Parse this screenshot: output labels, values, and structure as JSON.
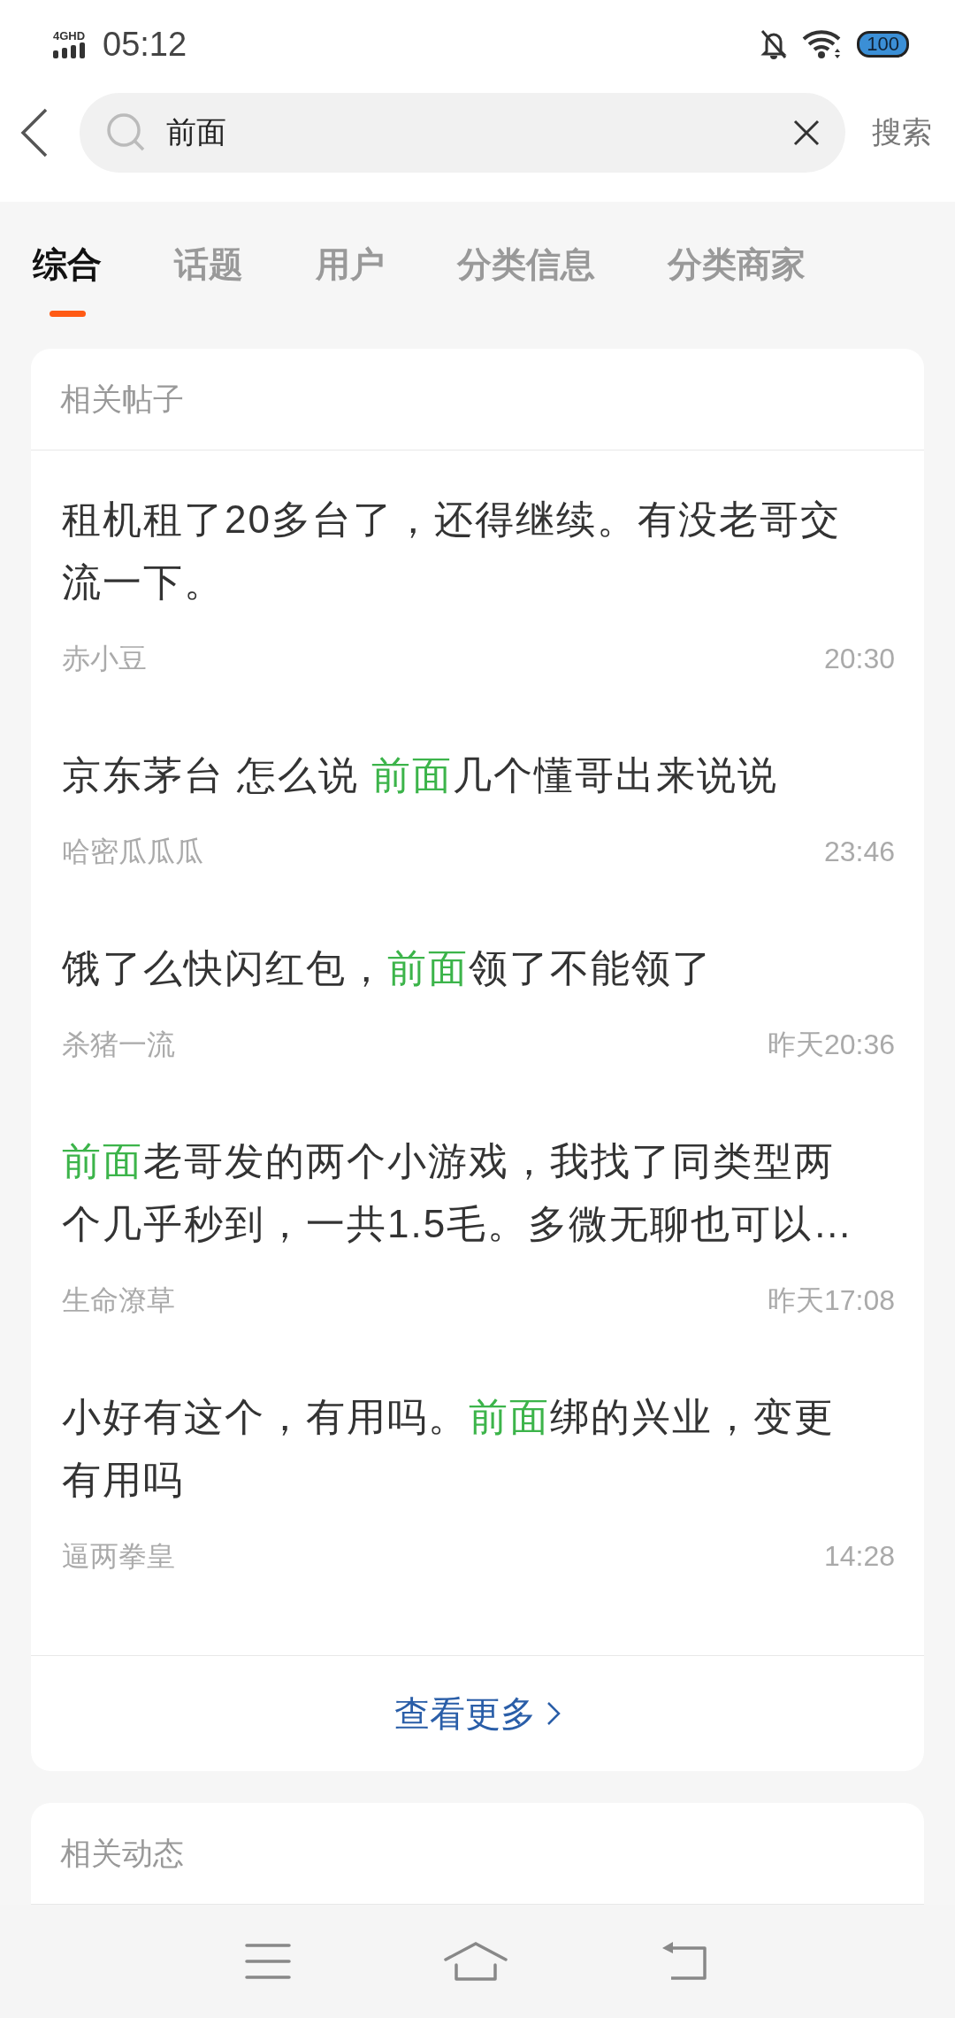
{
  "status_bar": {
    "network": "4G",
    "network_extra": "HD",
    "time": "05:12",
    "battery": "100"
  },
  "search": {
    "value": "前面",
    "button": "搜索"
  },
  "tabs": [
    {
      "label": "综合",
      "selected": true
    },
    {
      "label": "话题",
      "selected": false
    },
    {
      "label": "用户",
      "selected": false
    },
    {
      "label": "分类信息",
      "selected": false
    },
    {
      "label": "分类商家",
      "selected": false
    }
  ],
  "posts_section": {
    "title": "相关帖子",
    "posts": [
      {
        "title_parts": [
          {
            "text": "租机租了20多台了，还得继续。有没老哥交流一下。",
            "highlight": false
          }
        ],
        "author": "赤小豆",
        "time": "20:30"
      },
      {
        "title_parts": [
          {
            "text": "京东茅台 怎么说 ",
            "highlight": false
          },
          {
            "text": "前面",
            "highlight": true
          },
          {
            "text": "几个懂哥出来说说",
            "highlight": false
          }
        ],
        "author": "哈密瓜瓜瓜",
        "time": "23:46"
      },
      {
        "title_parts": [
          {
            "text": "饿了么快闪红包，",
            "highlight": false
          },
          {
            "text": "前面",
            "highlight": true
          },
          {
            "text": "领了不能领了",
            "highlight": false
          }
        ],
        "author": "杀猪一流",
        "time": "昨天20:36"
      },
      {
        "title_parts": [
          {
            "text": "前面",
            "highlight": true
          },
          {
            "text": "老哥发的两个小游戏，我找了同类型两个几乎秒到，一共1.5毛。多微无聊也可以…",
            "highlight": false
          }
        ],
        "author": "生命潦草",
        "time": "昨天17:08"
      },
      {
        "title_parts": [
          {
            "text": "小好有这个，有用吗。",
            "highlight": false
          },
          {
            "text": "前面",
            "highlight": true
          },
          {
            "text": "绑的兴业，变更有用吗",
            "highlight": false
          }
        ],
        "author": "逼两拳皇",
        "time": "14:28"
      }
    ],
    "more": "查看更多"
  },
  "moments_section": {
    "title": "相关动态"
  }
}
